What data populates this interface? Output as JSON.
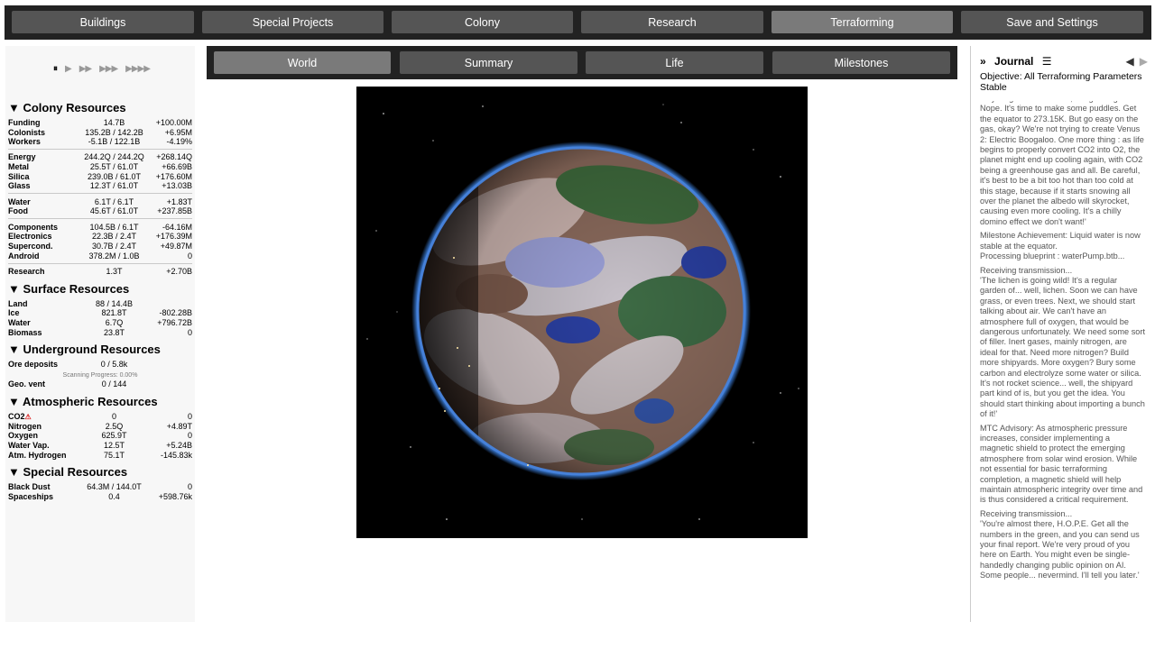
{
  "nav": {
    "tabs": [
      {
        "label": "Buildings"
      },
      {
        "label": "Special Projects"
      },
      {
        "label": "Colony"
      },
      {
        "label": "Research"
      },
      {
        "label": "Terraforming",
        "active": true
      },
      {
        "label": "Save and Settings"
      }
    ]
  },
  "speed": {
    "pause": "⏸",
    "s1": "▶",
    "s2": "▶▶",
    "s3": "▶▶▶",
    "s4": "▶▶▶▶"
  },
  "resources": {
    "colony": {
      "title": "▼ Colony Resources",
      "rows": [
        {
          "name": "Funding",
          "value": "14.7B",
          "rate": "+100.00M"
        },
        {
          "name": "Colonists",
          "value": "135.2B / 142.2B",
          "rate": "+6.95M"
        },
        {
          "name": "Workers",
          "value": "-5.1B / 122.1B",
          "rate": "-4.19%"
        },
        {
          "name": "Energy",
          "value": "244.2Q / 244.2Q",
          "rate": "+268.14Q"
        },
        {
          "name": "Metal",
          "value": "25.5T / 61.0T",
          "rate": "+66.69B"
        },
        {
          "name": "Silica",
          "value": "239.0B / 61.0T",
          "rate": "+176.60M"
        },
        {
          "name": "Glass",
          "value": "12.3T / 61.0T",
          "rate": "+13.03B"
        },
        {
          "name": "Water",
          "value": "6.1T / 6.1T",
          "rate": "+1.83T"
        },
        {
          "name": "Food",
          "value": "45.6T / 61.0T",
          "rate": "+237.85B"
        },
        {
          "name": "Components",
          "value": "104.5B / 6.1T",
          "rate": "-64.16M"
        },
        {
          "name": "Electronics",
          "value": "22.3B / 2.4T",
          "rate": "+176.39M"
        },
        {
          "name": "Supercond.",
          "value": "30.7B / 2.4T",
          "rate": "+49.87M"
        },
        {
          "name": "Android",
          "value": "378.2M / 1.0B",
          "rate": "0"
        },
        {
          "name": "Research",
          "value": "1.3T",
          "rate": "+2.70B"
        }
      ]
    },
    "surface": {
      "title": "▼ Surface Resources",
      "rows": [
        {
          "name": "Land",
          "value": "88 / 14.4B",
          "rate": ""
        },
        {
          "name": "Ice",
          "value": "821.8T",
          "rate": "-802.28B"
        },
        {
          "name": "Water",
          "value": "6.7Q",
          "rate": "+796.72B"
        },
        {
          "name": "Biomass",
          "value": "23.8T",
          "rate": "0"
        }
      ]
    },
    "underground": {
      "title": "▼ Underground Resources",
      "rows": [
        {
          "name": "Ore deposits",
          "value": "0 / 5.8k",
          "rate": ""
        },
        {
          "name": "Geo. vent",
          "value": "0 / 144",
          "rate": ""
        }
      ],
      "scanning": "Scanning Progress: 0.00%"
    },
    "atmospheric": {
      "title": "▼ Atmospheric Resources",
      "rows": [
        {
          "name": "CO2",
          "value": "0",
          "rate": "0",
          "warn": "⚠"
        },
        {
          "name": "Nitrogen",
          "value": "2.5Q",
          "rate": "+4.89T"
        },
        {
          "name": "Oxygen",
          "value": "625.9T",
          "rate": "0"
        },
        {
          "name": "Water Vap.",
          "value": "12.5T",
          "rate": "+5.24B"
        },
        {
          "name": "Atm. Hydrogen",
          "value": "75.1T",
          "rate": "-145.83k"
        }
      ]
    },
    "special": {
      "title": "▼ Special Resources",
      "rows": [
        {
          "name": "Black Dust",
          "value": "64.3M / 144.0T",
          "rate": "0"
        },
        {
          "name": "Spaceships",
          "value": "0.4",
          "rate": "+598.76k"
        }
      ]
    }
  },
  "subnav": {
    "tabs": [
      {
        "label": "World",
        "active": true
      },
      {
        "label": "Summary"
      },
      {
        "label": "Life"
      },
      {
        "label": "Milestones"
      }
    ]
  },
  "journal": {
    "collapse": "»",
    "title": "Journal",
    "menu": "☰",
    "prev": "◀",
    "next": "▶",
    "objective": "Objective: All Terraforming Parameters Stable",
    "entries": [
      "very long durations even, but growing? Nope. It's time to make some puddles. Get the equator to 273.15K. But go easy on the gas, okay? We're not trying to create Venus 2: Electric Boogaloo. One more thing : as life begins to properly convert CO2 into O2, the planet might end up cooling again, with CO2 being a greenhouse gas and all. Be careful, it's best to be a bit too hot than too cold at this stage, because if it starts snowing all over the planet the albedo will skyrocket, causing even more cooling. It's a chilly domino effect we don't want!'",
      "Milestone Achievement: Liquid water is now stable at the equator.\nProcessing blueprint : waterPump.btb...",
      "Receiving transmission...\n'The lichen is going wild! It's a regular garden of... well, lichen. Soon we can have grass, or even trees. Next, we should start talking about air. We can't have an atmosphere full of oxygen, that would be dangerous unfortunately. We need some sort of filler. Inert gases, mainly nitrogen, are ideal for that. Need more nitrogen? Build more shipyards. More oxygen? Bury some carbon and electrolyze some water or silica. It's not rocket science... well, the shipyard part kind of is, but you get the idea. You should start thinking about importing a bunch of it!'",
      "MTC Advisory: As atmospheric pressure increases, consider implementing a magnetic shield to protect the emerging atmosphere from solar wind erosion. While not essential for basic terraforming completion, a magnetic shield will help maintain atmospheric integrity over time and is thus considered a critical requirement.",
      "Receiving transmission...\n'You're almost there, H.O.P.E. Get all the numbers in the green, and you can send us your final report. We're very proud of you here on Earth. You might even be single-handedly changing public opinion on AI. Some people... nevermind. I'll tell you later.'"
    ]
  },
  "colors": {
    "nav_bg": "#222222",
    "tab_bg": "#555555",
    "tab_active": "#7a7a7a",
    "planet_atmosphere": "#3a7bd5"
  }
}
